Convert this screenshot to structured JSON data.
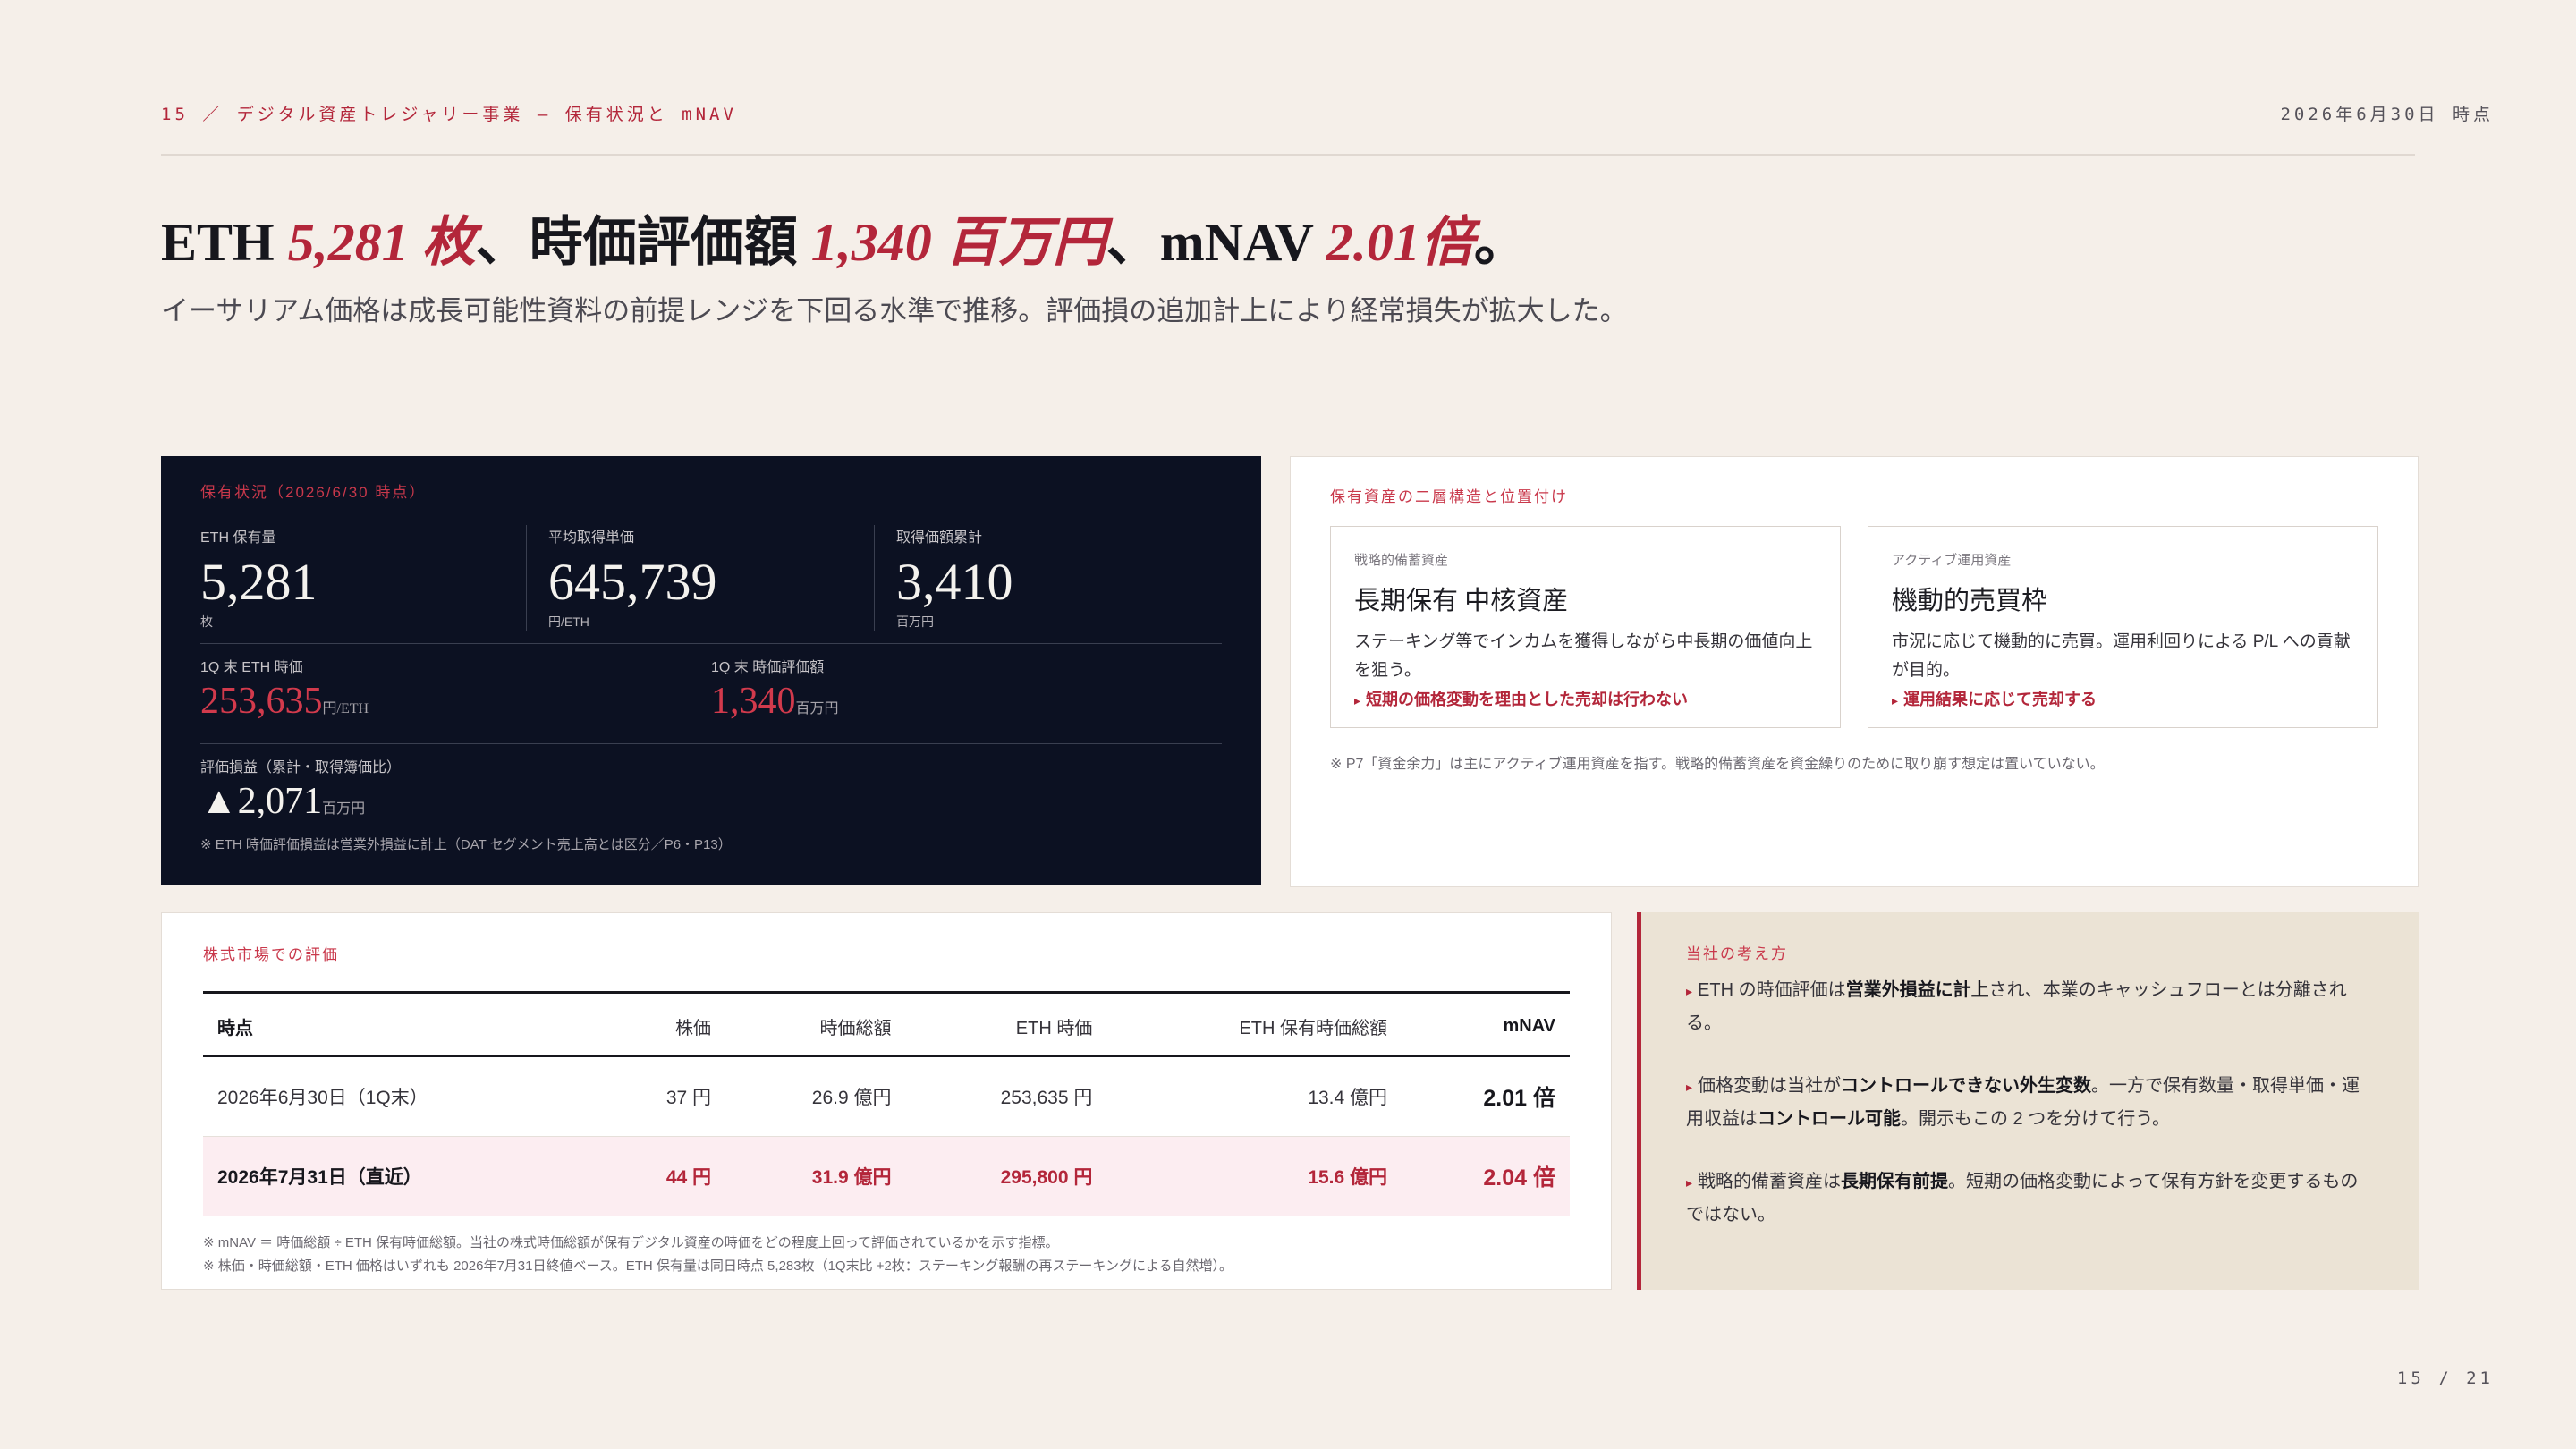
{
  "header": {
    "breadcrumb": "15 ／ デジタル資産トレジャリー事業 — 保有状況と mNAV",
    "as_of": "2026年6月30日 時点"
  },
  "headline": {
    "p1": "ETH ",
    "h1": "5,281 枚",
    "p2": "、時価評価額 ",
    "h2": "1,340 百万円",
    "p3": "、mNAV ",
    "h3": "2.01倍",
    "p4": "。"
  },
  "subline": "イーサリアム価格は成長可能性資料の前提レンジを下回る水準で推移。評価損の追加計上により経常損失が拡大した。",
  "holdings": {
    "label": "保有状況（2026/6/30 時点）",
    "eth": {
      "label": "ETH 保有量",
      "value": "5,281",
      "unit": "枚"
    },
    "avg": {
      "label": "平均取得単価",
      "value": "645,739",
      "unit": "円/ETH"
    },
    "cost": {
      "label": "取得価額累計",
      "value": "3,410",
      "unit": "百万円"
    },
    "price": {
      "label": "1Q 末 ETH 時価",
      "value": "253,635",
      "unit": "円/ETH"
    },
    "mval": {
      "label": "1Q 末 時価評価額",
      "value": "1,340",
      "unit": "百万円"
    },
    "pl": {
      "label": "評価損益（累計・取得簿価比）",
      "value": "▲2,071",
      "unit": "百万円"
    },
    "note": "※ ETH 時価評価損益は営業外損益に計上（DAT セグメント売上高とは区分／P6・P13）"
  },
  "structure": {
    "label": "保有資産の二層構造と位置付け",
    "left": {
      "kicker": "戦略的備蓄資産",
      "title": "長期保有 中核資産",
      "desc": "ステーキング等でインカムを獲得しながら中長期の価値向上を狙う。",
      "note": "短期の価格変動を理由とした売却は行わない"
    },
    "right": {
      "kicker": "アクティブ運用資産",
      "title": "機動的売買枠",
      "desc": "市況に応じて機動的に売買。運用利回りによる P/L への貢献が目的。",
      "note": "運用結果に応じて売却する"
    },
    "footnote": "※ P7「資金余力」は主にアクティブ運用資産を指す。戦略的備蓄資産を資金繰りのために取り崩す想定は置いていない。"
  },
  "valuation": {
    "label": "株式市場での評価",
    "headers": [
      "時点",
      "株価",
      "時価総額",
      "ETH 時価",
      "ETH 保有時価総額",
      "mNAV"
    ],
    "rows": [
      [
        "2026年6月30日（1Q末）",
        "37 円",
        "26.9 億円",
        "253,635 円",
        "13.4 億円",
        "2.01 倍"
      ],
      [
        "2026年7月31日（直近）",
        "44 円",
        "31.9 億円",
        "295,800 円",
        "15.6 億円",
        "2.04 倍"
      ]
    ],
    "note1": "※ mNAV ＝ 時価総額 ÷ ETH 保有時価総額。当社の株式時価総額が保有デジタル資産の時価をどの程度上回って評価されているかを示す指標。",
    "note2": "※ 株価・時価総額・ETH 価格はいずれも 2026年7月31日終値ベース。ETH 保有量は同日時点 5,283枚（1Q末比 +2枚：ステーキング報酬の再ステーキングによる自然増）。"
  },
  "policy": {
    "label": "当社の考え方",
    "items": [
      {
        "a": "ETH の時価評価は",
        "b": "営業外損益に計上",
        "c": "され、本業のキャッシュフローとは分離される。"
      },
      {
        "a": "価格変動は当社が",
        "b": "コントロールできない外生変数",
        "c": "。一方で保有数量・取得単価・運用収益は",
        "d": "コントロール可能",
        "e": "。開示もこの 2 つを分けて行う。"
      },
      {
        "a": "戦略的備蓄資産は",
        "b": "長期保有前提",
        "c": "。短期の価格変動によって保有方針を変更するものではない。"
      }
    ]
  },
  "pager": "15 / 21"
}
